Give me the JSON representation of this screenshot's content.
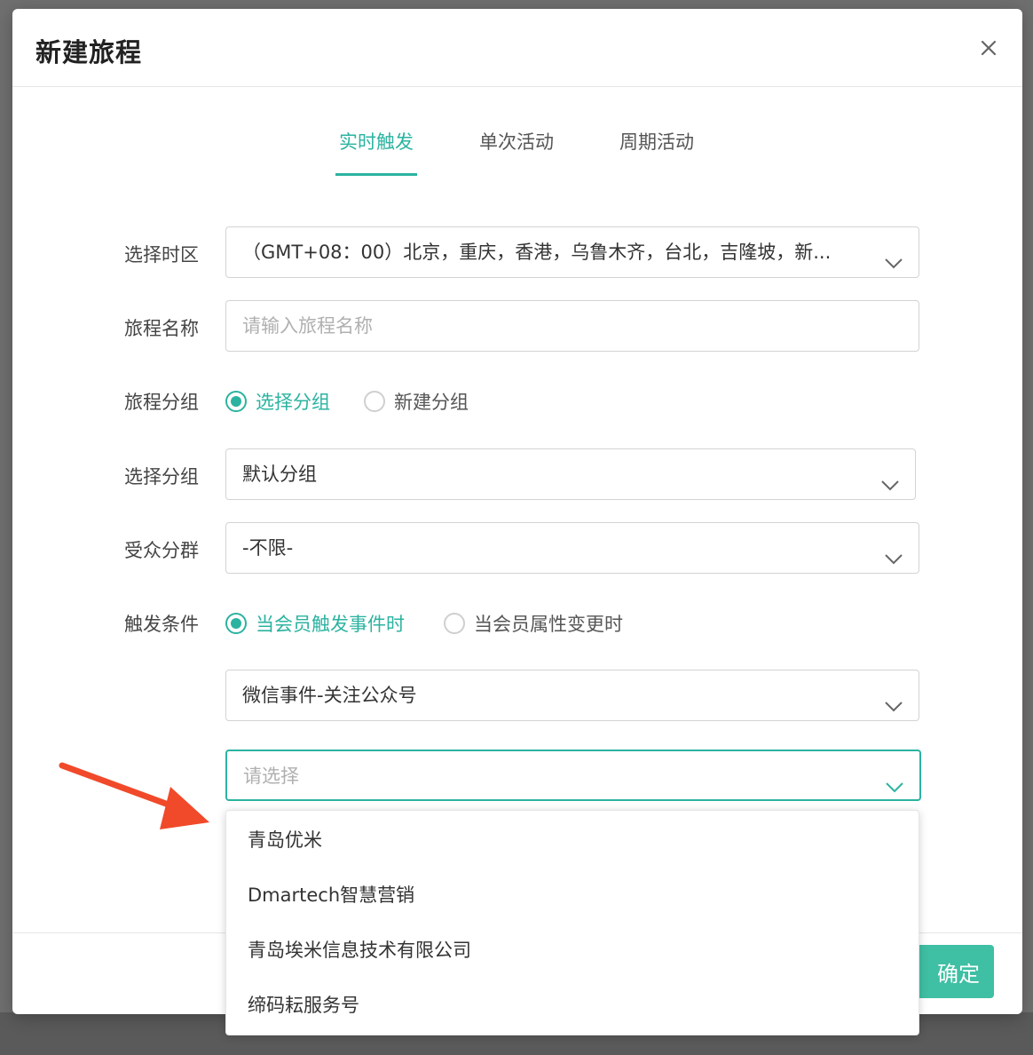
{
  "dialog": {
    "title": "新建旅程"
  },
  "tabs": [
    {
      "label": "实时触发",
      "active": true
    },
    {
      "label": "单次活动",
      "active": false
    },
    {
      "label": "周期活动",
      "active": false
    }
  ],
  "form": {
    "timezone": {
      "label": "选择时区",
      "value": "（GMT+08：00）北京，重庆，香港，乌鲁木齐，台北，吉隆坡，新..."
    },
    "journey_name": {
      "label": "旅程名称",
      "placeholder": "请输入旅程名称"
    },
    "journey_group": {
      "label": "旅程分组",
      "options": [
        {
          "label": "选择分组",
          "checked": true
        },
        {
          "label": "新建分组",
          "checked": false
        }
      ]
    },
    "select_group": {
      "label": "选择分组",
      "value": "默认分组"
    },
    "audience": {
      "label": "受众分群",
      "value": "-不限-"
    },
    "trigger": {
      "label": "触发条件",
      "options": [
        {
          "label": "当会员触发事件时",
          "checked": true
        },
        {
          "label": "当会员属性变更时",
          "checked": false
        }
      ]
    },
    "event": {
      "value": "微信事件-关注公众号"
    },
    "account": {
      "placeholder": "请选择"
    }
  },
  "dropdown": {
    "items": [
      "青岛优米",
      "Dmartech智慧营销",
      "青岛埃米信息技术有限公司",
      "缔码耘服务号"
    ]
  },
  "footer": {
    "confirm_label": "确定"
  },
  "colors": {
    "accent": "#2bb3a0",
    "confirm_bg": "#3fbfa3",
    "annotation_arrow": "#f04a2a"
  }
}
